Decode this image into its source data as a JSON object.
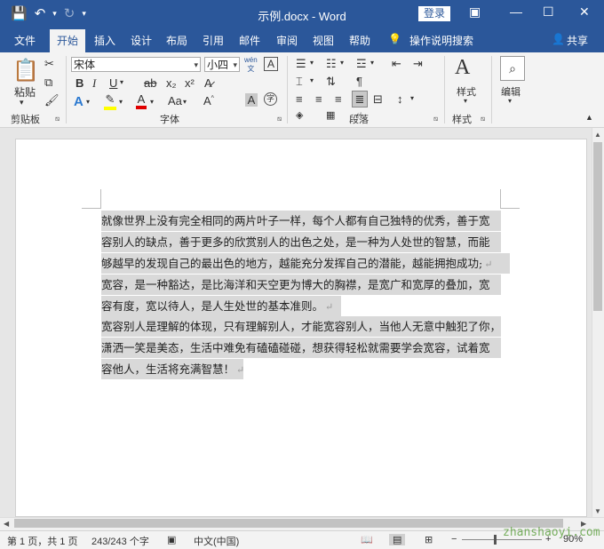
{
  "titlebar": {
    "doc_title": "示例.docx  -  Word",
    "login": "登录"
  },
  "tabs": [
    {
      "label": "文件"
    },
    {
      "label": "开始"
    },
    {
      "label": "插入"
    },
    {
      "label": "设计"
    },
    {
      "label": "布局"
    },
    {
      "label": "引用"
    },
    {
      "label": "邮件"
    },
    {
      "label": "审阅"
    },
    {
      "label": "视图"
    },
    {
      "label": "帮助"
    },
    {
      "label": "操作说明搜索"
    },
    {
      "label": "共享"
    }
  ],
  "ribbon": {
    "paste_label": "粘贴",
    "clipboard_group": "剪贴板",
    "font_group": "字体",
    "paragraph_group": "段落",
    "styles_group": "样式",
    "font_name": "宋体",
    "font_size": "小四",
    "wen_glyph": "wén",
    "styles_label": "样式",
    "edit_label": "编辑"
  },
  "document": {
    "lines": [
      "就像世界上没有完全相同的两片叶子一样，每个人都有自己独特的优秀，善于宽",
      "容别人的缺点，善于更多的欣赏别人的出色之处，是一种为人处世的智慧，而能",
      "够越早的发现自己的最出色的地方，越能充分发挥自己的潜能，越能拥抱成功;",
      "宽容，是一种豁达，是比海洋和天空更为博大的胸襟，是宽广和宽厚的叠加，宽",
      "容有度，宽以待人，是人生处世的基本准则。",
      "宽容别人是理解的体现，只有理解别人，才能宽容别人，当他人无意中触犯了你，",
      "潇洒一笑是美态，生活中难免有磕磕碰碰，想获得轻松就需要学会宽容，试着宽",
      "容他人，生活将充满智慧！"
    ],
    "para_mark": "↵"
  },
  "statusbar": {
    "page": "第 1 页，共 1 页",
    "words": "243/243 个字",
    "language": "中文(中国)",
    "zoom": "90%"
  },
  "watermark": "zhanshaoyi.com"
}
